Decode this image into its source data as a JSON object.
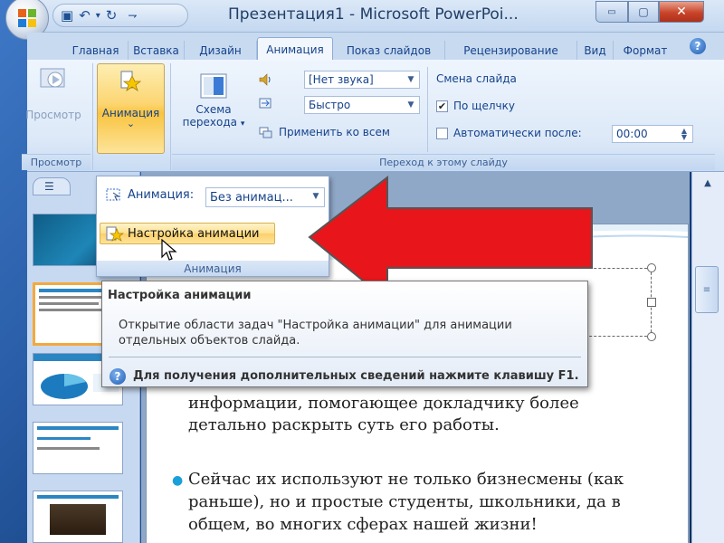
{
  "window": {
    "title": "Презентация1 - Microsoft PowerPoi...",
    "min_glyph": "▭",
    "max_glyph": "▢",
    "close_glyph": "✕"
  },
  "qat": {
    "save_glyph": "▣",
    "undo_glyph": "↶",
    "undo_arrow": "▾",
    "redo_glyph": "↻",
    "customize_glyph": "⇁"
  },
  "tabs": [
    {
      "label": "Главная"
    },
    {
      "label": "Вставка"
    },
    {
      "label": "Дизайн"
    },
    {
      "label": "Анимация",
      "active": true
    },
    {
      "label": "Показ слайдов"
    },
    {
      "label": "Рецензирование"
    },
    {
      "label": "Вид"
    },
    {
      "label": "Формат"
    }
  ],
  "ribbon": {
    "preview": {
      "label": "Просмотр",
      "group": "Просмотр"
    },
    "animation": {
      "label": "Анимация",
      "arrow": "⌄"
    },
    "transition_scheme": {
      "label_line1": "Схема",
      "label_line2": "перехода",
      "arrow": "▾"
    },
    "sound_combo": {
      "value": "[Нет звука]"
    },
    "speed_combo": {
      "value": "Быстро"
    },
    "apply_all": {
      "label": "Применить ко всем"
    },
    "change_slide": {
      "label": "Смена слайда"
    },
    "on_click": {
      "label": "По щелчку",
      "checked": true
    },
    "auto_after": {
      "label": "Автоматически после:",
      "checked": false,
      "value": "00:00"
    },
    "transition_group": "Переход к этому слайду"
  },
  "anim_panel": {
    "anim_label": "Анимация:",
    "anim_combo_value": "Без анимац...",
    "custom_item": "Настройка анимации",
    "footer": "Анимация"
  },
  "tooltip": {
    "title": "Настройка анимации",
    "body": "Открытие области задач \"Настройка анимации\" для анимации отдельных объектов слайда.",
    "help": "Для получения дополнительных сведений нажмите клавишу F1."
  },
  "slide": {
    "line1": "информации, помогающее докладчику более",
    "line2": "детально раскрыть суть его работы.",
    "bullet_line1": "Сейчас их используют не только бизнесмены (как",
    "bullet_line2": "раньше), но и простые студенты, школьники, да в",
    "bullet_line3": "общем, во многих сферах нашей жизни!"
  },
  "colors": {
    "accent_red": "#e8161b",
    "ribbon_highlight": "#fcd571",
    "thumb_selected": "#f4a93c"
  }
}
